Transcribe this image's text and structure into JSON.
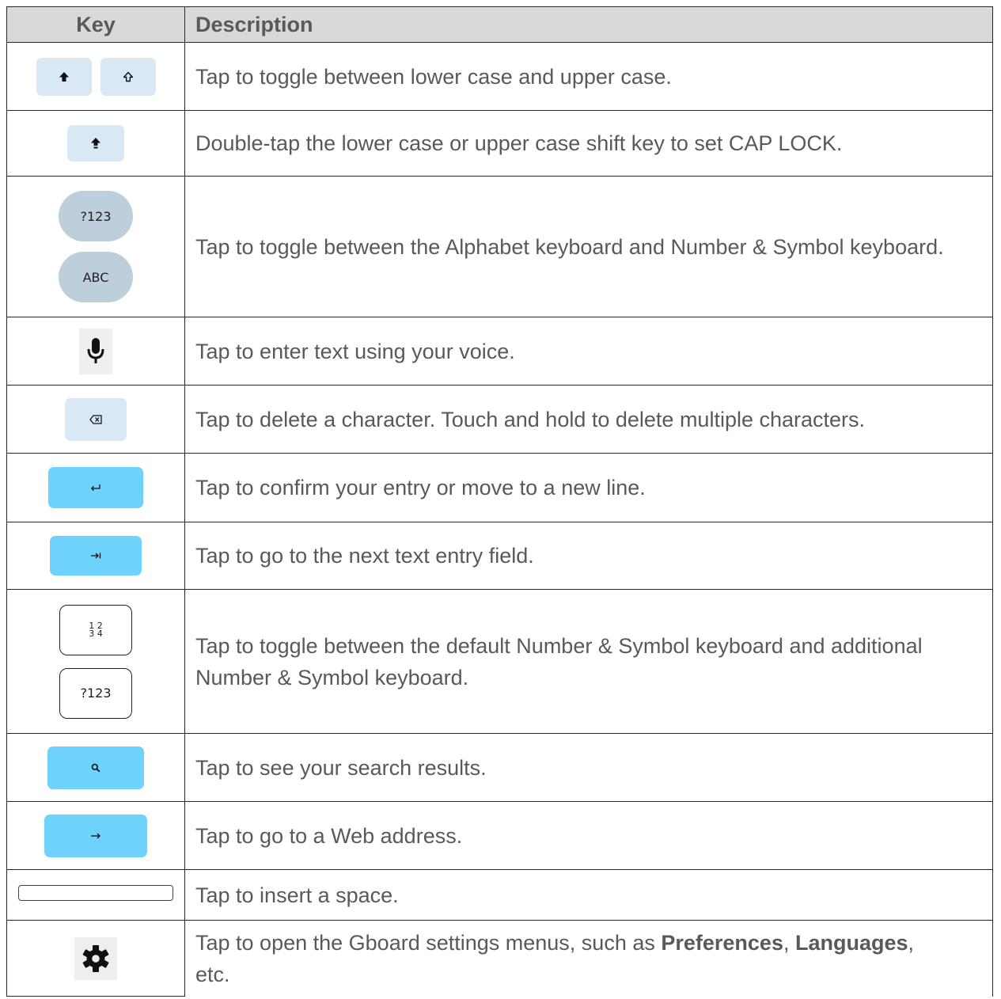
{
  "header": {
    "key": "Key",
    "description": "Description"
  },
  "rows": [
    {
      "key_icons": [
        "shift-lowercase-icon",
        "shift-uppercase-icon"
      ],
      "description": "Tap to toggle between lower case and upper case."
    },
    {
      "key_icons": [
        "caps-lock-icon"
      ],
      "description": "Double-tap the lower case or upper case shift key to set CAP LOCK."
    },
    {
      "key_labels": [
        "?123",
        "ABC"
      ],
      "description": "Tap to toggle between the Alphabet keyboard and Number & Symbol keyboard."
    },
    {
      "key_icons": [
        "microphone-icon"
      ],
      "description": "Tap to enter text using your voice."
    },
    {
      "key_icons": [
        "backspace-icon"
      ],
      "description": "Tap to delete a character. Touch and hold to delete multiple characters."
    },
    {
      "key_icons": [
        "enter-icon"
      ],
      "description": "Tap to confirm your entry or move to a new line."
    },
    {
      "key_icons": [
        "tab-next-icon"
      ],
      "description": "Tap to go to the next text entry field."
    },
    {
      "key_labels": [
        "1 2",
        "3 4",
        "?123"
      ],
      "description": "Tap to toggle between the default Number & Symbol keyboard and additional Number & Symbol keyboard."
    },
    {
      "key_icons": [
        "search-icon"
      ],
      "description": "Tap to see your search results."
    },
    {
      "key_icons": [
        "arrow-right-icon"
      ],
      "description": "Tap to go to a Web address."
    },
    {
      "key_icons": [
        "space-bar-icon"
      ],
      "description": "Tap to insert a space."
    },
    {
      "key_icons": [
        "gear-icon"
      ],
      "description_parts": [
        "Tap to open the Gboard settings menus, such as ",
        "Preferences",
        ", ",
        "Languages",
        ",",
        "etc."
      ]
    }
  ]
}
